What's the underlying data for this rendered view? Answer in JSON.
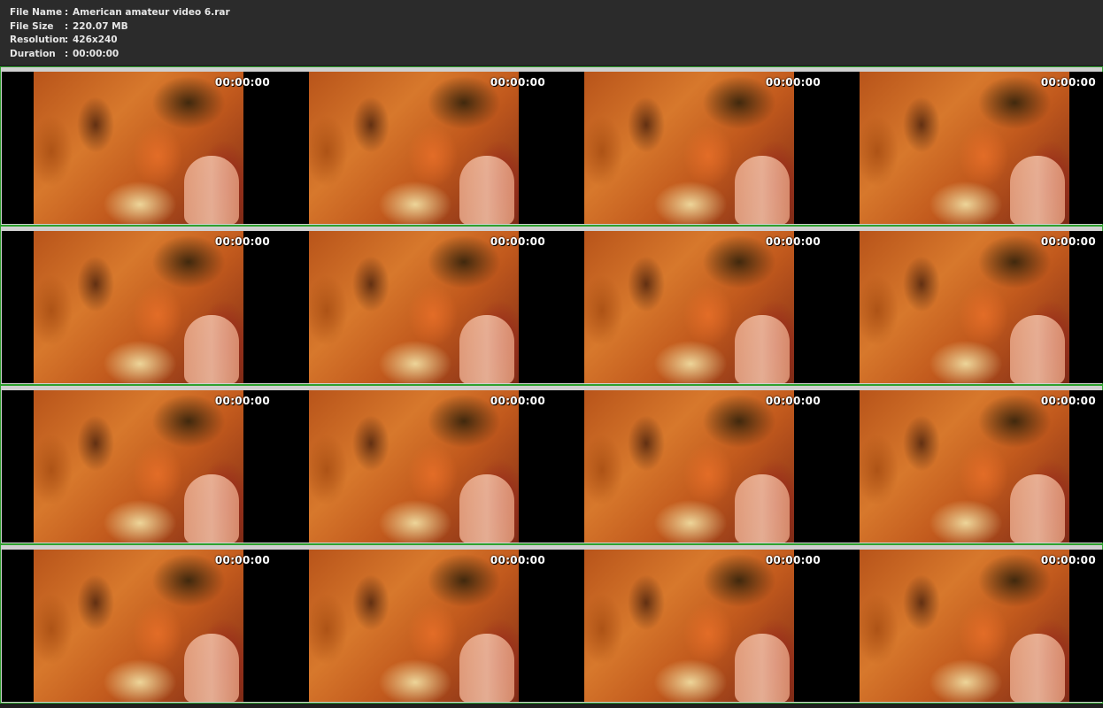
{
  "file_info": [
    {
      "label": "File Name",
      "sep": ":",
      "value": "American amateur video 6.rar"
    },
    {
      "label": "File Size",
      "sep": ":",
      "value": "220.07 MB"
    },
    {
      "label": "Resolution",
      "sep": ":",
      "value": "426x240"
    },
    {
      "label": "Duration",
      "sep": ":",
      "value": "00:00:00"
    }
  ],
  "thumbnails": {
    "rows": 4,
    "cols": 4,
    "timestamps": [
      [
        "00:00:00",
        "00:00:00",
        "00:00:00",
        "00:00:00"
      ],
      [
        "00:00:00",
        "00:00:00",
        "00:00:00",
        "00:00:00"
      ],
      [
        "00:00:00",
        "00:00:00",
        "00:00:00",
        "00:00:00"
      ],
      [
        "00:00:00",
        "00:00:00",
        "00:00:00",
        "00:00:00"
      ]
    ]
  },
  "colors": {
    "background": "#2b2b2b",
    "row_border": "#2fa12f",
    "text": "#e6e6e6",
    "timestamp_text": "#ffffff"
  }
}
